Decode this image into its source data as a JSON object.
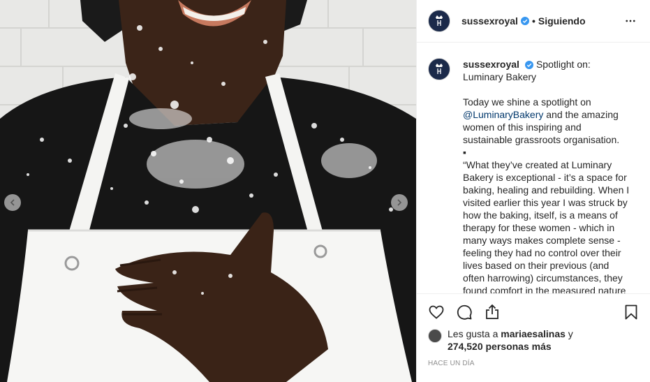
{
  "post": {
    "header": {
      "username": "sussexroyal",
      "separator": "•",
      "follow_status": "Siguiendo",
      "more_icon": "ellipsis-icon"
    },
    "caption": {
      "username": "sussexroyal",
      "title": "Spotlight on: Luminary Bakery",
      "intro_before_mention": "Today we shine a spotlight on ",
      "mention": "@LuminaryBakery",
      "intro_after_mention": " and the amazing women of this inspiring and sustainable grassroots organisation.",
      "bullet": "▪",
      "quote": "“What they’ve created at Luminary Bakery is exceptional - it’s a space for baking, healing and rebuilding. When I visited earlier this year I was struck by how the baking, itself, is a means of therapy for these women - which in many ways makes complete sense - feeling they had no control over their lives based on their previous (and often harrowing) circumstances, they found comfort in the measured nature"
    },
    "actions": {
      "like_icon": "heart-icon",
      "comment_icon": "comment-icon",
      "share_icon": "share-icon",
      "save_icon": "bookmark-icon"
    },
    "likes": {
      "prefix": "Les gusta a ",
      "liker": "mariaesalinas",
      "middle": " y",
      "count": "274,520",
      "suffix": " personas más"
    },
    "time_ago": "HACE UN DÍA"
  },
  "colors": {
    "brand_navy": "#1b2a4a",
    "verified_blue": "#3897f0",
    "mention_blue": "#00376b",
    "meta_gray": "#8e8e8e"
  }
}
